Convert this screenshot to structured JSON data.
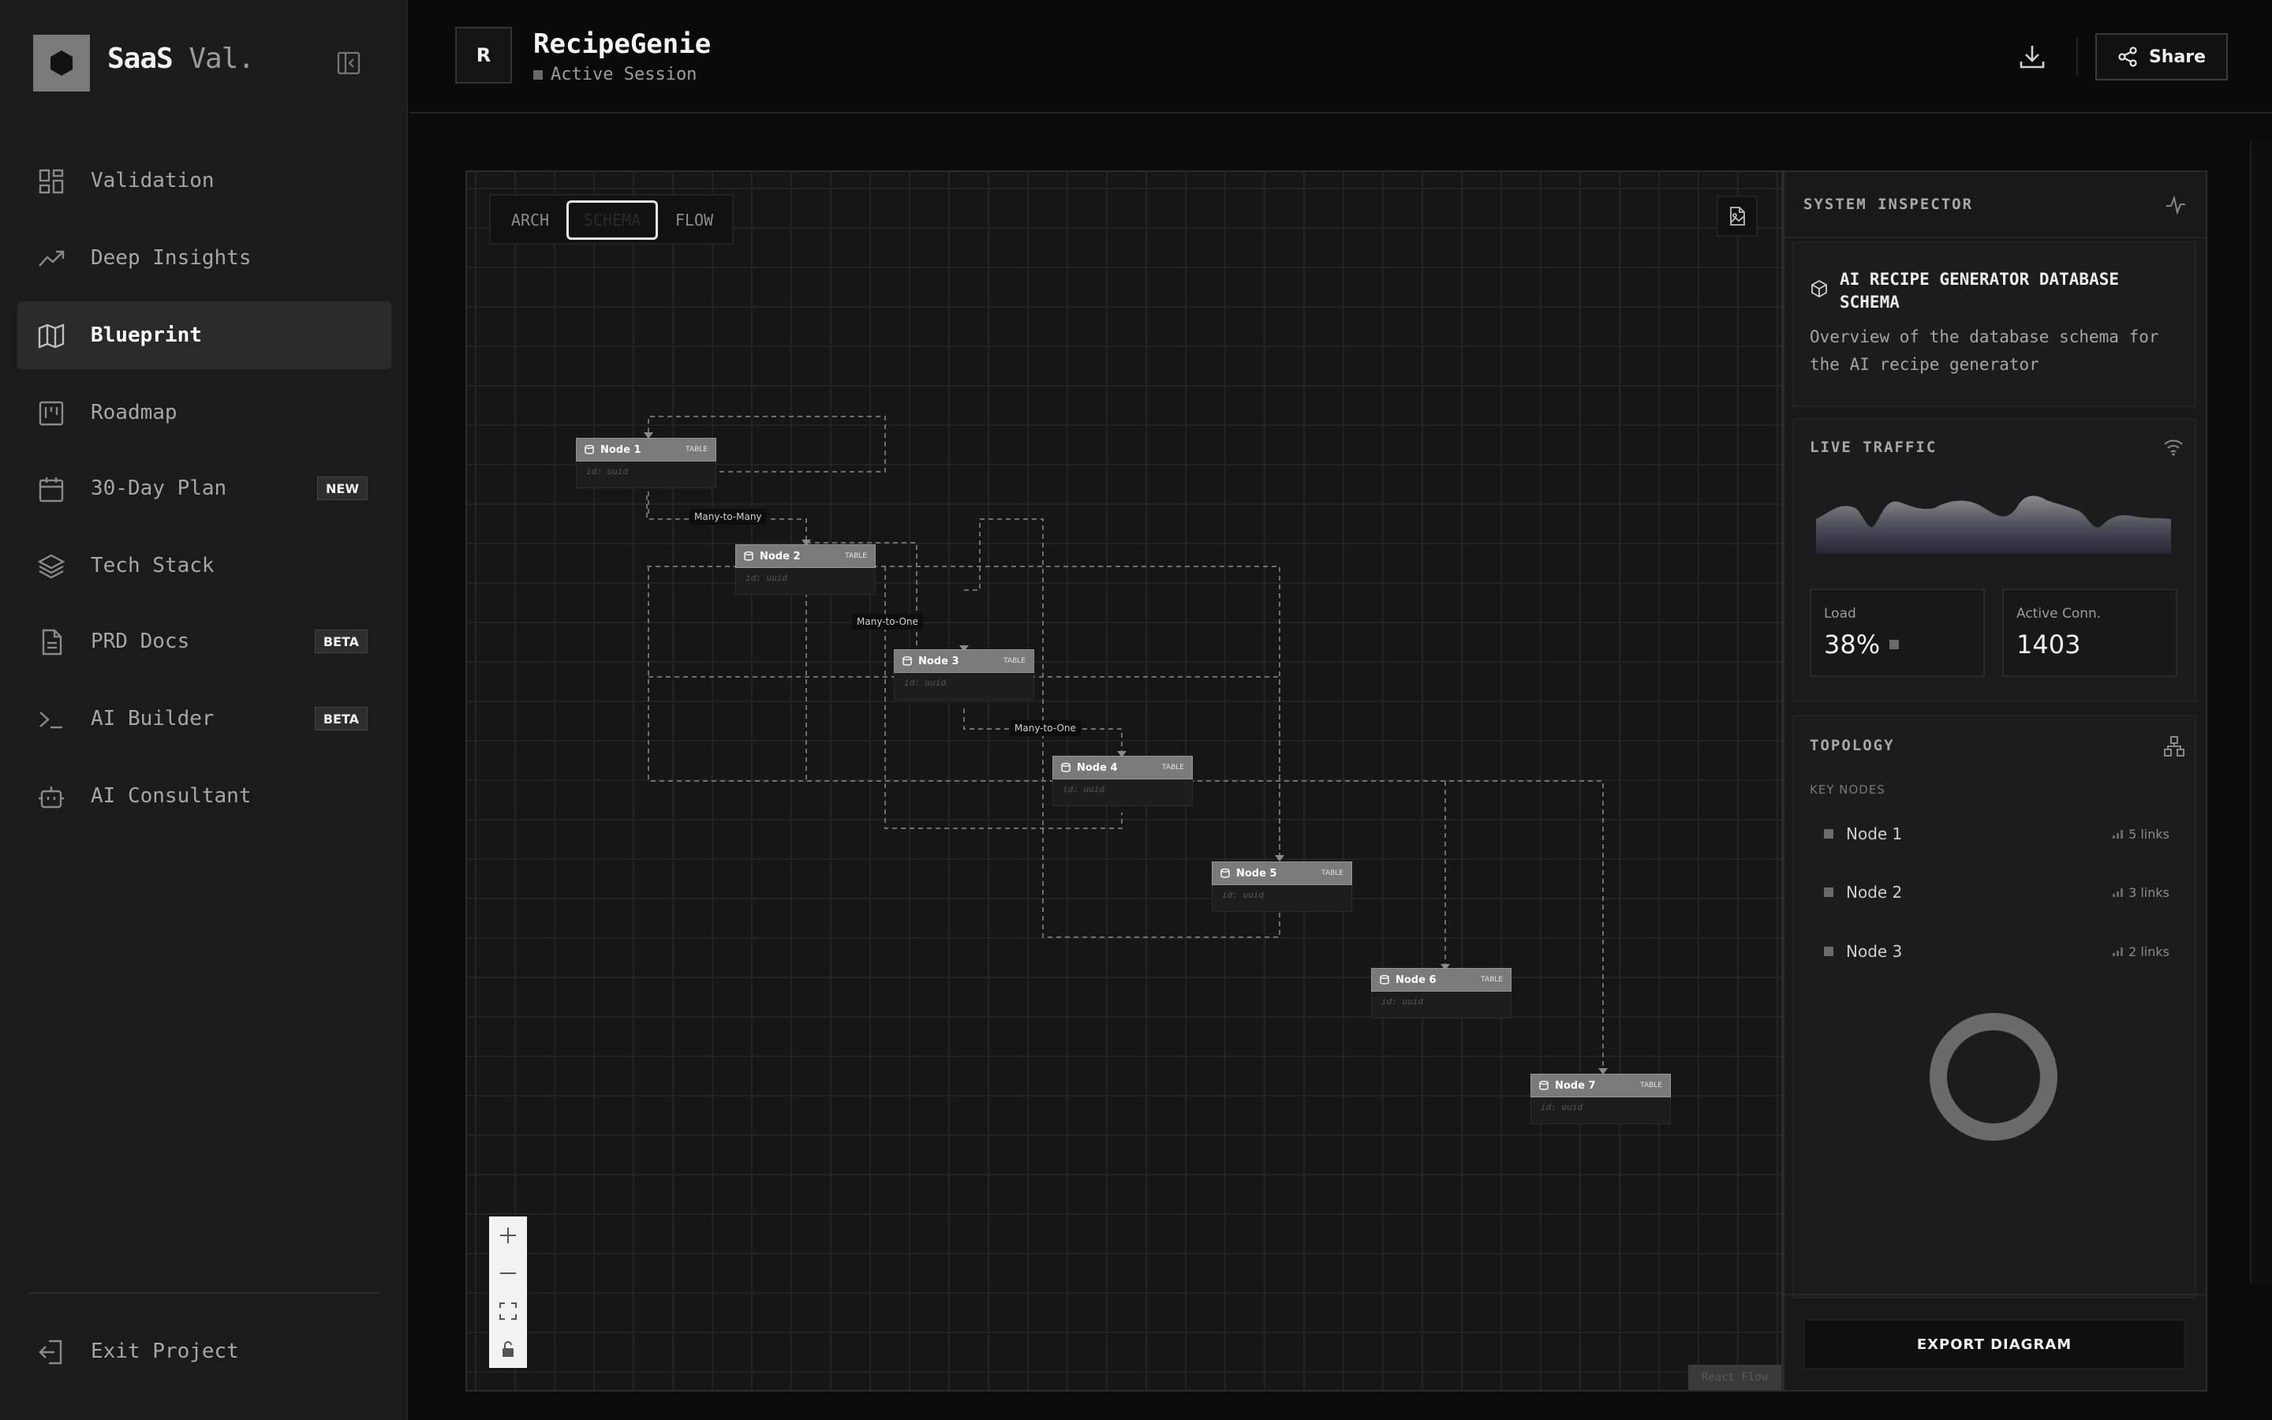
{
  "sidebar": {
    "brand": "SaaS",
    "brand_suffix": " Val.",
    "items": [
      {
        "label": "Validation",
        "icon": "grid-icon",
        "active": false
      },
      {
        "label": "Deep Insights",
        "icon": "trending-up-icon",
        "active": false
      },
      {
        "label": "Blueprint",
        "icon": "map-icon",
        "active": true
      },
      {
        "label": "Roadmap",
        "icon": "kanban-icon",
        "active": false
      },
      {
        "label": "30-Day Plan",
        "icon": "calendar-icon",
        "active": false,
        "badge": "NEW"
      },
      {
        "label": "Tech Stack",
        "icon": "layers-icon",
        "active": false
      },
      {
        "label": "PRD Docs",
        "icon": "document-icon",
        "active": false,
        "badge": "BETA"
      },
      {
        "label": "AI Builder",
        "icon": "terminal-icon",
        "active": false,
        "badge": "BETA"
      },
      {
        "label": "AI Consultant",
        "icon": "bot-icon",
        "active": false
      }
    ],
    "exit_label": "Exit Project"
  },
  "header": {
    "avatar_letter": "R",
    "project_title": "RecipeGenie",
    "status": "Active Session",
    "share_label": "Share"
  },
  "canvas": {
    "view_tabs": [
      "ARCH",
      "SCHEMA",
      "FLOW"
    ],
    "active_tab": "SCHEMA",
    "nodes": [
      {
        "name": "Node 1",
        "tag": "TABLE",
        "field": "id: uuid"
      },
      {
        "name": "Node 2",
        "tag": "TABLE",
        "field": "id: uuid"
      },
      {
        "name": "Node 3",
        "tag": "TABLE",
        "field": "id: uuid"
      },
      {
        "name": "Node 4",
        "tag": "TABLE",
        "field": "id: uuid"
      },
      {
        "name": "Node 5",
        "tag": "TABLE",
        "field": "id: uuid"
      },
      {
        "name": "Node 6",
        "tag": "TABLE",
        "field": "id: uuid"
      },
      {
        "name": "Node 7",
        "tag": "TABLE",
        "field": "id: uuid"
      }
    ],
    "edge_labels": [
      "Many-to-Many",
      "Many-to-One",
      "Many-to-One"
    ],
    "watermark": "React Flow"
  },
  "inspector": {
    "title": "SYSTEM INSPECTOR",
    "schema_title": "AI RECIPE GENERATOR DATABASE SCHEMA",
    "schema_desc": "Overview of the database schema for the AI recipe generator",
    "live_traffic_title": "LIVE TRAFFIC",
    "load_label": "Load",
    "load_value": "38%",
    "conn_label": "Active Conn.",
    "conn_value": "1403",
    "topology_title": "TOPOLOGY",
    "key_nodes_label": "KEY NODES",
    "key_nodes": [
      {
        "name": "Node 1",
        "links": "5 links"
      },
      {
        "name": "Node 2",
        "links": "3 links"
      },
      {
        "name": "Node 3",
        "links": "2 links"
      }
    ],
    "export_label": "EXPORT DIAGRAM"
  },
  "colors": {
    "accent_traffic": "#3a3a55",
    "node_header": "#7a7a7a"
  }
}
